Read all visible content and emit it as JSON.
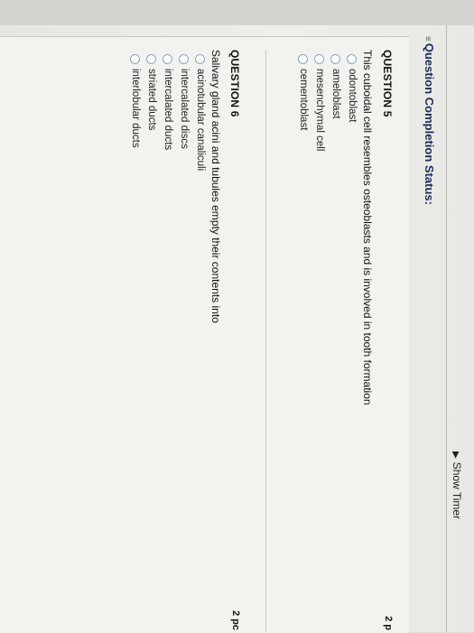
{
  "header": {
    "show_timer": "Show Timer",
    "completion_status": "Question Completion Status:"
  },
  "questions": [
    {
      "heading": "QUESTION 5",
      "points": "2 p",
      "prompt": "This cuboidal cell resembles osteoblasts and is involved in tooth formation",
      "options": [
        "odontoblast",
        "ameloblast",
        "mesenchymal cell",
        "cementoblast"
      ]
    },
    {
      "heading": "QUESTION 6",
      "points": "2 pc",
      "prompt": "Salivary gland acini and tubules empty their contents into",
      "options": [
        "acinotubular canaliculi",
        "intercalated discs",
        "intercalated ducts",
        "striated ducts",
        "interlobular ducts"
      ]
    }
  ]
}
